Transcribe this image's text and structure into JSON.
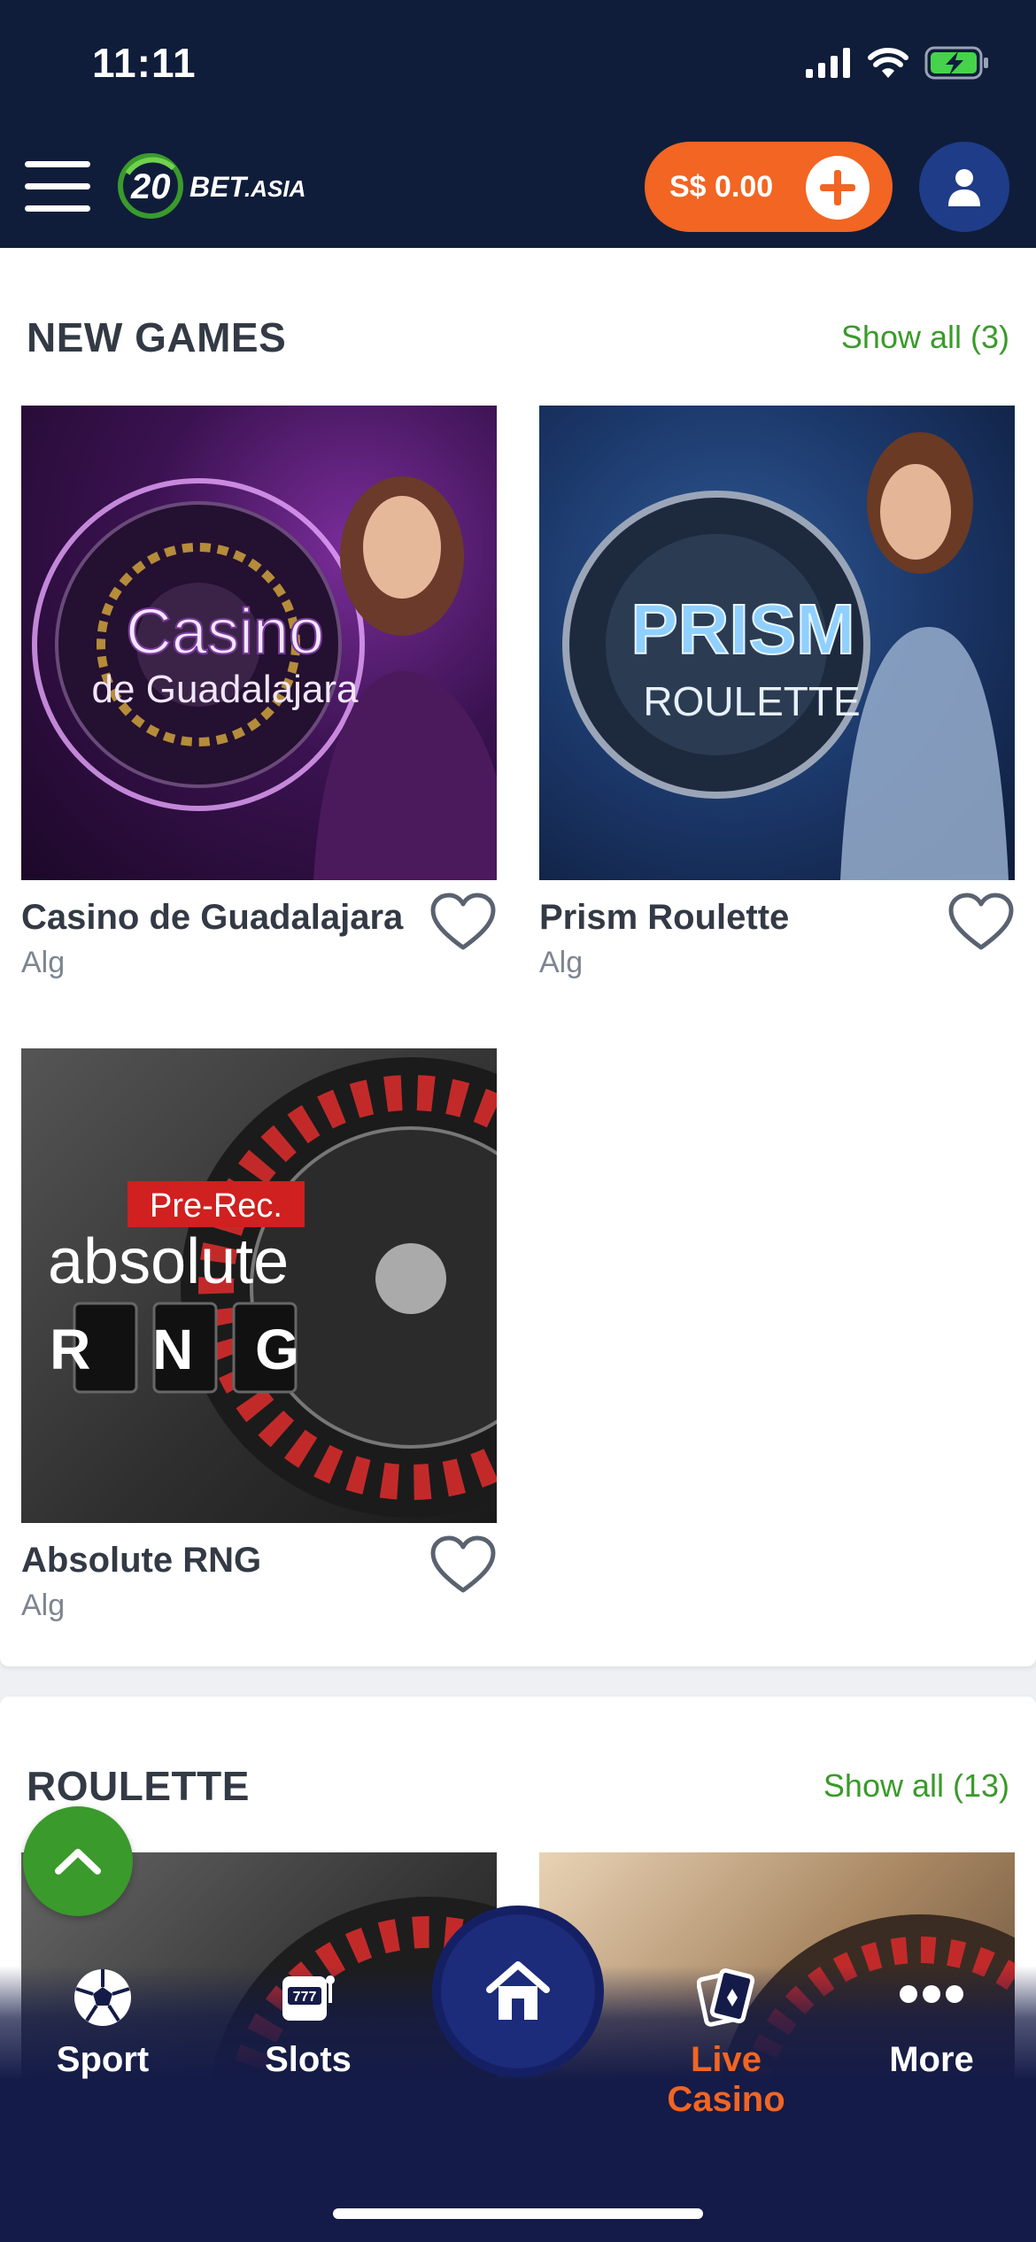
{
  "status_bar": {
    "time": "11:11"
  },
  "header": {
    "logo_number": "20",
    "logo_text": "BET",
    "logo_suffix": ".ASIA",
    "balance": "S$ 0.00"
  },
  "new_games": {
    "title": "NEW GAMES",
    "show_all": "Show all (3)",
    "games": [
      {
        "name": "Casino de Guadalajara",
        "provider": "Alg",
        "art_line1": "Casino",
        "art_line2": "de Guadalajara"
      },
      {
        "name": "Prism Roulette",
        "provider": "Alg",
        "art_line1": "PRISM",
        "art_line2": "ROULETTE"
      },
      {
        "name": "Absolute RNG",
        "provider": "Alg",
        "art_line1": "Pre-Rec.",
        "art_line2": "absolute",
        "art_line3": "R N G"
      }
    ]
  },
  "roulette": {
    "title": "ROULETTE",
    "show_all": "Show all (13)"
  },
  "bottom_nav": {
    "items": [
      {
        "label": "Sport",
        "icon": "soccer-ball-icon"
      },
      {
        "label": "Slots",
        "icon": "slot-machine-icon"
      },
      {
        "label": "",
        "icon": "home-icon"
      },
      {
        "label": "Live Casino",
        "icon": "cards-icon",
        "active": true
      },
      {
        "label": "More",
        "icon": "more-dots-icon"
      }
    ]
  },
  "colors": {
    "header_bg": "#0f1d3a",
    "accent_orange": "#f26522",
    "accent_green": "#3a9a2b",
    "nav_bg": "#141b48"
  }
}
